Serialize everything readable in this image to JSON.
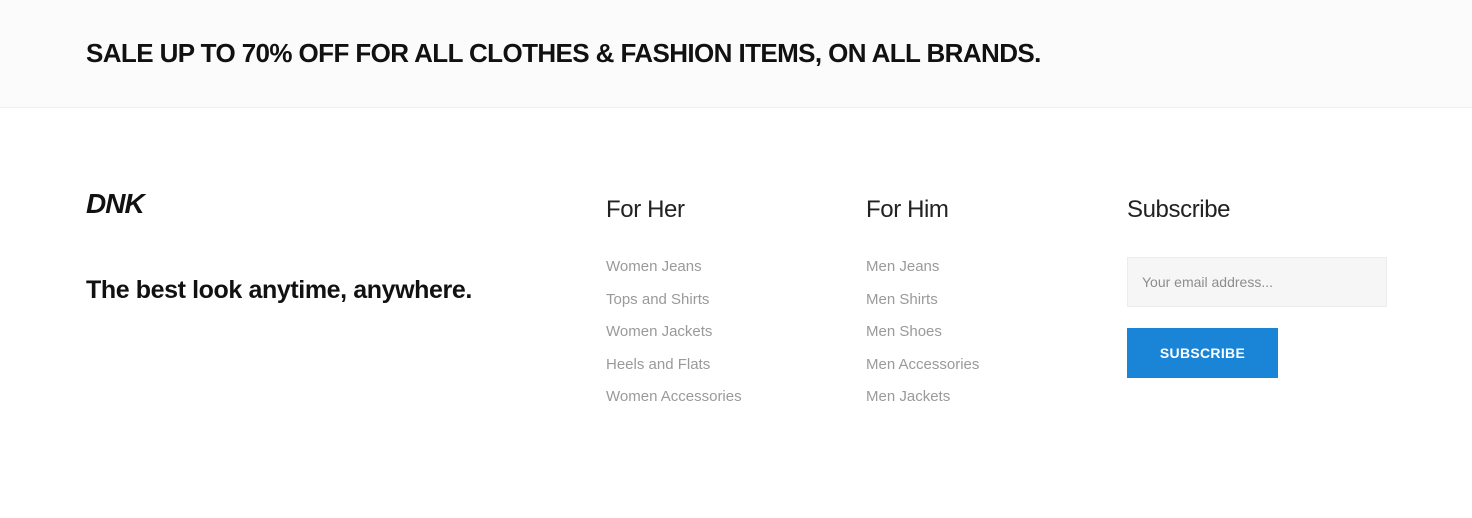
{
  "banner": {
    "text": "SALE UP TO 70% OFF FOR ALL CLOTHES & FASHION ITEMS, ON ALL BRANDS."
  },
  "footer": {
    "logo_text": "DNK",
    "tagline": "The best look anytime, anywhere.",
    "for_her": {
      "title": "For Her",
      "links": [
        "Women Jeans",
        "Tops and Shirts",
        "Women Jackets",
        "Heels and Flats",
        "Women Accessories"
      ]
    },
    "for_him": {
      "title": "For Him",
      "links": [
        "Men Jeans",
        "Men Shirts",
        "Men Shoes",
        "Men Accessories",
        "Men Jackets"
      ]
    },
    "subscribe": {
      "title": "Subscribe",
      "email_placeholder": "Your email address...",
      "button_label": "SUBSCRIBE"
    }
  },
  "colors": {
    "accent": "#1a84d6",
    "link": "#9a9a9a",
    "text": "#111111",
    "banner_bg": "#fbfbfb"
  }
}
